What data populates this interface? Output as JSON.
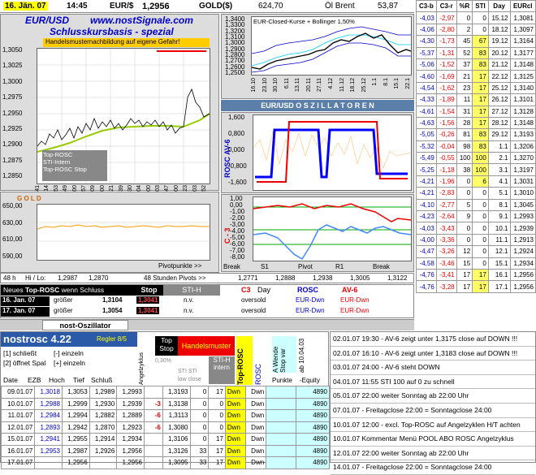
{
  "topbar": {
    "date": "16. Jän. 07",
    "time": "14:45",
    "pair_label": "EUR/$",
    "pair_value": "1,2956",
    "gold_label": "GOLD($)",
    "gold_value": "624,70",
    "oil_label": "Öl Brent",
    "oil_value": "53,87"
  },
  "header": {
    "symbol": "EUR/USD",
    "site": "www.nostSignale.com",
    "subtitle": "Schlusskursbasis - spezial",
    "warning": "Handelsmusternachbildung auf eigene Gefahr!"
  },
  "left_chart": {
    "yticks": [
      "1,3050",
      "1,3025",
      "1,3000",
      "1,2975",
      "1,2950",
      "1,2925",
      "1,2900",
      "1,2875",
      "1,2850"
    ],
    "xticks": [
      "07:41",
      "10:14",
      "12:53",
      "15:49",
      "18:00",
      "20:57",
      "00:09",
      "03:00",
      "06:21",
      "09:39",
      "12:30",
      "15:04",
      "18:00",
      "21:03",
      "23:47",
      "03:00",
      "06:23",
      "10:03",
      "13:52"
    ],
    "legend": [
      "Top-ROSC",
      "STI-Intern",
      "Top-ROSC Stop"
    ]
  },
  "gold_chart": {
    "label": "G O L D",
    "yticks": [
      "650,00",
      "630,00",
      "610,00",
      "590,00"
    ],
    "footer": "Pivotpunkte >>"
  },
  "boll_chart": {
    "title": "EUR-Closed-Kurse + Bollinger 1,50%",
    "yticks": [
      "1,3400",
      "1,3300",
      "1,3200",
      "1,3100",
      "1,3000",
      "1,2900",
      "1,2800",
      "1,2700",
      "1,2600",
      "1,2500"
    ],
    "xticks": [
      "16.10",
      "23.10",
      "30.10",
      "6.11",
      "13.11",
      "20.11",
      "27.11",
      "4.12",
      "11.12",
      "18.12",
      "25.12",
      "1.1",
      "8.1",
      "15.1",
      "22.1"
    ]
  },
  "osc": {
    "title": "EUR/USD  O S Z I L L A T O R E N",
    "rosc_axis": "ROSC  AV-6",
    "rosc_yticks": [
      "1,600",
      "0,800",
      "0,000",
      "-0,800",
      "-1,600"
    ],
    "c3_axis": "C - 3",
    "c3_yticks": [
      "1,00",
      "0,00",
      "-1,00",
      "-2,00",
      "-3,00",
      "-4,00",
      "-5,00",
      "-6,00",
      "-7,00",
      "-8,00"
    ],
    "pivot_labels": [
      "Break",
      "S1",
      "Pivot",
      "R1",
      "Break"
    ]
  },
  "pivots": {
    "period": "48 h",
    "hilo": "Hi / Lo:",
    "hi": "1,2987",
    "lo": "1,2870",
    "label": "48 Stunden Pivots >>",
    "values": [
      "1,2771",
      "1,2888",
      "1,2938",
      "1,3005",
      "1,3122"
    ]
  },
  "signal": {
    "head1": "Neues",
    "head2": "Top-ROSC",
    "head3": "wenn Schluss",
    "stop": "Stop",
    "sti": "STI-H",
    "c3": "C3",
    "day": "Day",
    "rosc": "ROSC",
    "av6": "AV-6",
    "rows": [
      {
        "date": "16. Jan. 07",
        "cond": "größer",
        "val": "1,3104",
        "stop": "1,3041",
        "sti": "n.v.",
        "c3": "oversold",
        "rosc": "EUR-Dwn",
        "av6": "EUR-Dwn"
      },
      {
        "date": "17. Jan. 07",
        "cond": "größer",
        "val": "1,3054",
        "stop": "1,3041",
        "sti": "n.v.",
        "c3": "oversold",
        "rosc": "EUR-Dwn",
        "av6": "EUR-Dwn"
      }
    ]
  },
  "tab_label": "nost-Oszillator",
  "right_table": {
    "headers": [
      "C3-b",
      "C3-r",
      "%R",
      "STI",
      "Day",
      "EURcl"
    ],
    "rows": [
      [
        "-4,03",
        "-2,97",
        "0",
        "0",
        "15.12",
        "1,3081"
      ],
      [
        "-4,06",
        "-2,80",
        "2",
        "0",
        "18.12",
        "1,3097"
      ],
      [
        "-4,30",
        "-1,73",
        "45",
        "67",
        "19.12",
        "1,3164"
      ],
      [
        "-5,37",
        "-1,31",
        "52",
        "83",
        "20.12",
        "1,3177"
      ],
      [
        "-5,06",
        "-1,52",
        "37",
        "83",
        "21.12",
        "1,3148"
      ],
      [
        "-4,60",
        "-1,69",
        "21",
        "17",
        "22.12",
        "1,3125"
      ],
      [
        "-4,54",
        "-1,62",
        "23",
        "17",
        "25.12",
        "1,3140"
      ],
      [
        "-4,33",
        "-1,89",
        "11",
        "17",
        "26.12",
        "1,3101"
      ],
      [
        "-4,61",
        "-1,54",
        "31",
        "17",
        "27.12",
        "1,3128"
      ],
      [
        "-4,63",
        "-1,56",
        "28",
        "17",
        "28.12",
        "1,3148"
      ],
      [
        "-5,05",
        "-0,26",
        "81",
        "83",
        "29.12",
        "1,3193"
      ],
      [
        "-5,32",
        "-0,04",
        "98",
        "83",
        "1.1",
        "1,3206"
      ],
      [
        "-5,49",
        "-0,55",
        "100",
        "100",
        "2.1",
        "1,3270"
      ],
      [
        "-5,25",
        "-1,18",
        "38",
        "100",
        "3.1",
        "1,3197"
      ],
      [
        "-4,21",
        "-1,96",
        "0",
        "6",
        "4.1",
        "1,3031"
      ],
      [
        "-4,21",
        "-2,83",
        "0",
        "0",
        "5.1",
        "1,3010"
      ],
      [
        "-4,10",
        "-2,77",
        "5",
        "0",
        "8.1",
        "1,3045"
      ],
      [
        "-4,23",
        "-2,64",
        "9",
        "0",
        "9.1",
        "1,2993"
      ],
      [
        "-4,03",
        "-3,43",
        "0",
        "0",
        "10.1",
        "1,2939"
      ],
      [
        "-4,00",
        "-3,36",
        "0",
        "0",
        "11.1",
        "1,2913"
      ],
      [
        "-4,47",
        "-3,26",
        "12",
        "0",
        "12.1",
        "1,2924"
      ],
      [
        "-4,58",
        "-3,46",
        "15",
        "0",
        "15.1",
        "1,2934"
      ],
      [
        "-4,76",
        "-3,41",
        "17",
        "17",
        "16.1",
        "1,2956"
      ],
      [
        "-4,76",
        "-3,28",
        "17",
        "17",
        "17.1",
        "1,2956"
      ]
    ]
  },
  "bottom": {
    "title": "nostrosc 4.22",
    "regler": "Regler 8/5",
    "opt1": "[1] schließt",
    "opt1b": "[-] einzeln",
    "opt2": "[2] öffnet Spal",
    "opt2b": "[+] einzeln",
    "cols": [
      "Date",
      "EZB",
      "Hoch",
      "Tief",
      "Schluß"
    ],
    "winkel": "Angelzyklus",
    "topstop": "Top Stop",
    "handels": "Handelsmuster",
    "pct": "0,30%",
    "sti_low": "STI STI",
    "lowclose": "low close",
    "stih": "STI-H intern",
    "toprosc": "Top-ROSC",
    "rosc": "ROSC",
    "wende": "A Wende Stop var",
    "punkte": "Punkte",
    "equity": "-Equity",
    "ab": "ab 10.04.03",
    "rows": [
      [
        "09.01.07",
        "1,3018",
        "1,3053",
        "1,2989",
        "1,2993",
        "",
        "1,3193",
        "0",
        "17",
        "Dwn",
        "Dwn",
        "",
        "4890"
      ],
      [
        "10.01.07",
        "1,2988",
        "1,2999",
        "1,2930",
        "1,2939",
        "-3",
        "1,3138",
        "0",
        "0",
        "Dwn",
        "Dwn",
        "",
        "4890"
      ],
      [
        "11.01.07",
        "1,2984",
        "1,2994",
        "1,2882",
        "1,2889",
        "-6",
        "1,3113",
        "0",
        "0",
        "Dwn",
        "Dwn",
        "",
        "4890"
      ],
      [
        "12.01.07",
        "1,2893",
        "1,2942",
        "1,2870",
        "1,2923",
        "-6",
        "1,3080",
        "0",
        "0",
        "Dwn",
        "Dwn",
        "",
        "4890"
      ],
      [
        "15.01.07",
        "1,2941",
        "1,2955",
        "1,2914",
        "1,2934",
        "",
        "1,3106",
        "0",
        "17",
        "Dwn",
        "Dwn",
        "",
        "4890"
      ],
      [
        "16.01.07",
        "1,2953",
        "1,2987",
        "1,2926",
        "1,2956",
        "",
        "1,3126",
        "33",
        "17",
        "Dwn",
        "Dwn",
        "",
        "4890"
      ],
      [
        "17.01.07",
        "",
        "1,2956",
        "",
        "1,2956",
        "",
        "1,3095",
        "33",
        "17",
        "Dwn",
        "Dwn",
        "",
        "4890"
      ]
    ]
  },
  "messages": [
    "02.01.07 19:30 - AV-6 zeigt unter 1,3175 close auf DOWN !!!",
    "02.01.07 16:10 - AV-6 zeigt unter 1,3183 close auf DOWN !!!",
    "03.01.07 24:00 - AV-6 steht DOWN",
    "04.01.07 11:55 STI 100 auf 0 zu schnell",
    "05.01.07 22:00 weiter Sonntag ab 22:00 Uhr",
    "07.01.07 - Freitagclose 22:00 = Sonntagclose 24:00",
    "10.01.07 12:00 - excl. Top-ROSC auf Angelzyklen H/T achten",
    "10.01.07 Kommentar Menü POOL ABO ROSC Angelzyklus",
    "12.01.07 22:00 weiter Sonntag ab 22:00 Uhr",
    "14.01.07 - Freitagclose 22:00 = Sonntagclose 24:00"
  ]
}
